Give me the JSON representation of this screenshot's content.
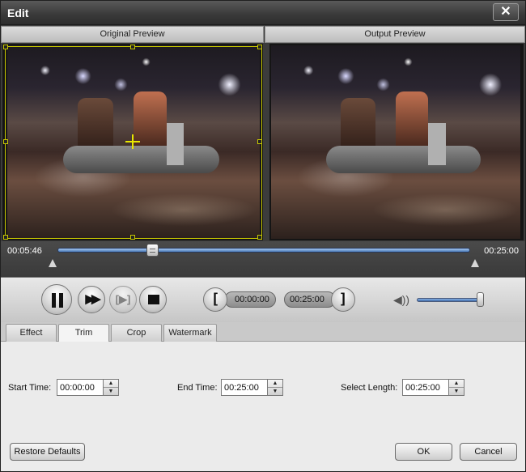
{
  "window": {
    "title": "Edit",
    "close_label": "✕"
  },
  "preview": {
    "original_label": "Original Preview",
    "output_label": "Output Preview"
  },
  "timeline": {
    "current_time": "00:05:46",
    "total_time": "00:25:00",
    "progress_fraction": 0.23
  },
  "controls": {
    "start_time": "00:00:00",
    "end_time": "00:25:00",
    "start_bracket": "[",
    "end_bracket": "]",
    "volume_fraction": 0.95
  },
  "tabs": [
    {
      "label": "Effect",
      "active": false
    },
    {
      "label": "Trim",
      "active": true
    },
    {
      "label": "Crop",
      "active": false
    },
    {
      "label": "Watermark",
      "active": false
    }
  ],
  "trim": {
    "start_label": "Start Time:",
    "start_value": "00:00:00",
    "end_label": "End Time:",
    "end_value": "00:25:00",
    "length_label": "Select Length:",
    "length_value": "00:25:00"
  },
  "buttons": {
    "restore": "Restore Defaults",
    "ok": "OK",
    "cancel": "Cancel"
  },
  "icons": {
    "pause": "pause-icon",
    "fast_forward": "fast-forward-icon",
    "next_frame": "next-frame-icon",
    "stop": "stop-icon",
    "speaker": "speaker-icon"
  }
}
